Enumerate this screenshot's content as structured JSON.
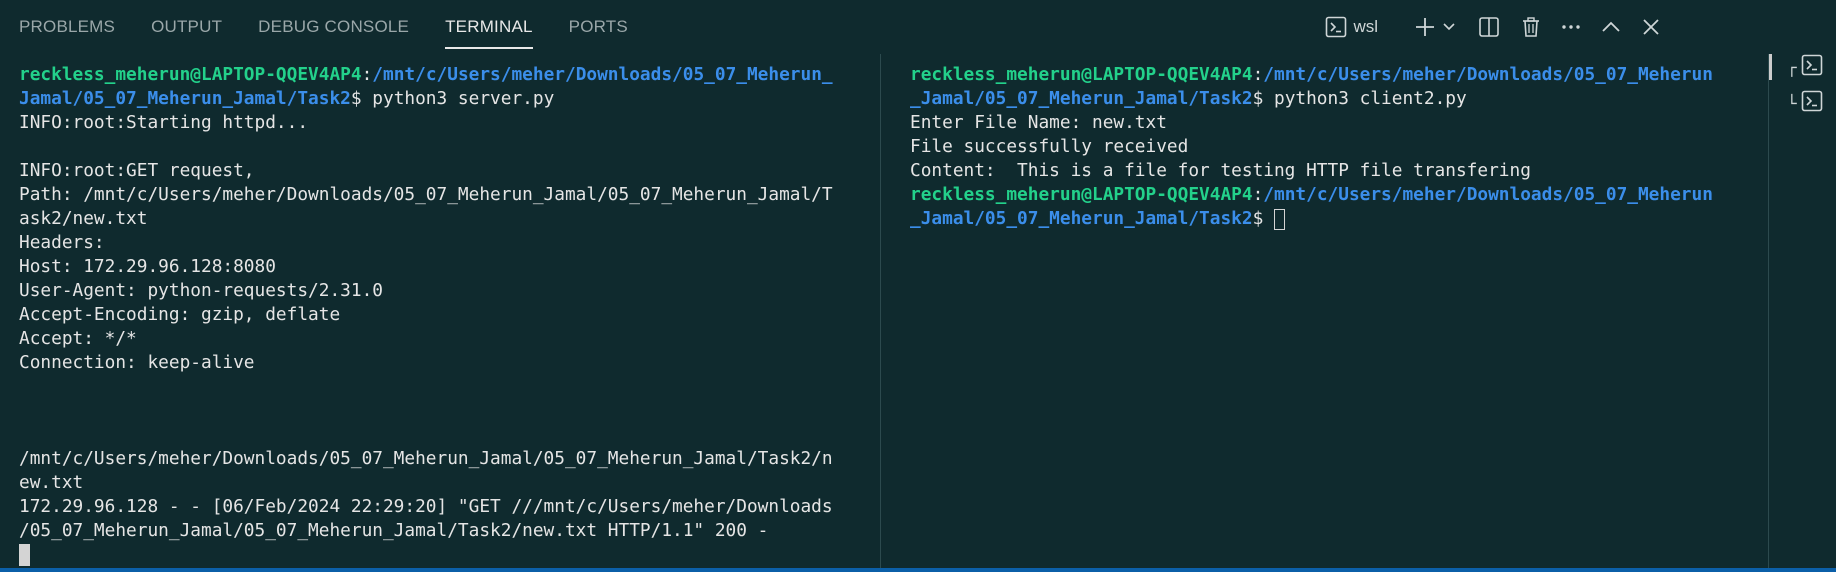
{
  "tabs": [
    {
      "label": "PROBLEMS"
    },
    {
      "label": "OUTPUT"
    },
    {
      "label": "DEBUG CONSOLE"
    },
    {
      "label": "TERMINAL"
    },
    {
      "label": "PORTS"
    }
  ],
  "active_tab": "TERMINAL",
  "actions": {
    "shell_label": "wsl",
    "icons": [
      "terminal-icon",
      "plus-icon",
      "chevron-down-icon",
      "split-icon",
      "trash-icon",
      "more-icon",
      "chevron-up-icon",
      "close-icon"
    ]
  },
  "left_terminal": {
    "prompt_user": "reckless_meherun@LAPTOP-QQEV4AP4",
    "prompt_sep": ":",
    "prompt_path_1": "/mnt/c/Users/meher/Downloads/05_07_Meherun_",
    "prompt_path_2": "Jamal/05_07_Meherun_Jamal/Task2",
    "prompt_cmd": "$ python3 server.py",
    "lines": [
      "INFO:root:Starting httpd...",
      "",
      "INFO:root:GET request,",
      "Path: /mnt/c/Users/meher/Downloads/05_07_Meherun_Jamal/05_07_Meherun_Jamal/T",
      "ask2/new.txt",
      "Headers:",
      "Host: 172.29.96.128:8080",
      "User-Agent: python-requests/2.31.0",
      "Accept-Encoding: gzip, deflate",
      "Accept: */*",
      "Connection: keep-alive",
      "",
      "",
      "",
      "/mnt/c/Users/meher/Downloads/05_07_Meherun_Jamal/05_07_Meherun_Jamal/Task2/n",
      "ew.txt",
      "172.29.96.128 - - [06/Feb/2024 22:29:20] \"GET ///mnt/c/Users/meher/Downloads",
      "/05_07_Meherun_Jamal/05_07_Meherun_Jamal/Task2/new.txt HTTP/1.1\" 200 -"
    ]
  },
  "right_terminal": {
    "prompt_user": "reckless_meherun@LAPTOP-QQEV4AP4",
    "prompt_sep": ":",
    "prompt_path_1": "/mnt/c/Users/meher/Downloads/05_07_Meherun",
    "prompt_path_2": "_Jamal/05_07_Meherun_Jamal/Task2",
    "prompt_cmd": "$ python3 client2.py",
    "lines": [
      "Enter File Name: new.txt",
      "File successfully received",
      "Content:  This is a file for testing HTTP file transfering"
    ],
    "prompt2_cmd": "$ "
  },
  "terminal_list": [
    {
      "tree": "┌"
    },
    {
      "tree": "└"
    }
  ]
}
